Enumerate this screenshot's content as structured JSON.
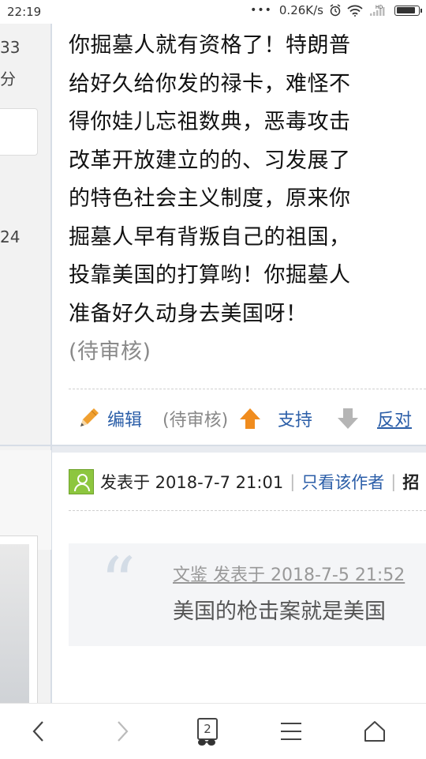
{
  "status_bar": {
    "time": "22:19",
    "more": "•••",
    "speed": "0.26K/s",
    "network_badge": "HD"
  },
  "left_column": {
    "number_1": "33",
    "label_1": "分",
    "number_2": "24"
  },
  "post": {
    "lines": [
      "你掘墓人就有资格了！特朗普",
      "给好久给你发的禄卡，难怪不",
      "得你娃儿忘祖数典，恶毒攻击",
      "改革开放建立的的、习发展了",
      "的特色社会主义制度，原来你",
      "掘墓人早有背叛自己的祖国，",
      "投靠美国的打算哟！你掘墓人",
      "准备好久动身去美国呀！"
    ],
    "pending": "(待审核)"
  },
  "actions": {
    "edit": "编辑",
    "pending": "(待审核)",
    "support": "支持",
    "oppose": "反对"
  },
  "next_post": {
    "posted_at": "发表于 2018-7-7 21:01",
    "only_author": "只看该作者",
    "cut_char": "招",
    "quote_meta": "文鉴 发表于 2018-7-5 21:52",
    "quote_text": "美国的枪击案就是美国"
  },
  "bottom_nav": {
    "tab_count": "2"
  },
  "colors": {
    "link": "#2b5ea8",
    "edit_pencil": "#f0a030",
    "up_arrow": "#f08c1e",
    "down_arrow": "#b5b5b5",
    "avatar": "#8dc63f"
  }
}
